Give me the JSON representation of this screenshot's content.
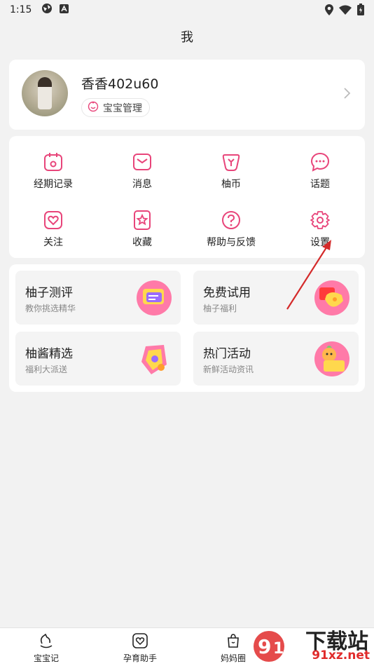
{
  "status_bar": {
    "time": "1:15"
  },
  "header": {
    "title": "我"
  },
  "profile": {
    "username": "香香402u60",
    "baby_manage": "宝宝管理"
  },
  "grid": [
    {
      "label": "经期记录",
      "icon": "calendar-icon"
    },
    {
      "label": "消息",
      "icon": "mail-icon"
    },
    {
      "label": "柚币",
      "icon": "coin-icon"
    },
    {
      "label": "话题",
      "icon": "chat-icon"
    },
    {
      "label": "关注",
      "icon": "heart-icon"
    },
    {
      "label": "收藏",
      "icon": "star-bookmark-icon"
    },
    {
      "label": "帮助与反馈",
      "icon": "help-icon"
    },
    {
      "label": "设置",
      "icon": "gear-icon"
    }
  ],
  "promos": [
    {
      "title": "柚子测评",
      "subtitle": "教你挑选精华"
    },
    {
      "title": "免费试用",
      "subtitle": "柚子福利"
    },
    {
      "title": "柚酱精选",
      "subtitle": "福利大派送"
    },
    {
      "title": "热门活动",
      "subtitle": "新鲜活动资讯"
    }
  ],
  "bottom_nav": [
    {
      "label": "宝宝记"
    },
    {
      "label": "孕育助手"
    },
    {
      "label": "妈妈圈"
    }
  ],
  "watermark": {
    "text": "下载站",
    "url": "91xz.net"
  },
  "colors": {
    "accent": "#e8457a",
    "annotation_arrow": "#d42a2a"
  }
}
